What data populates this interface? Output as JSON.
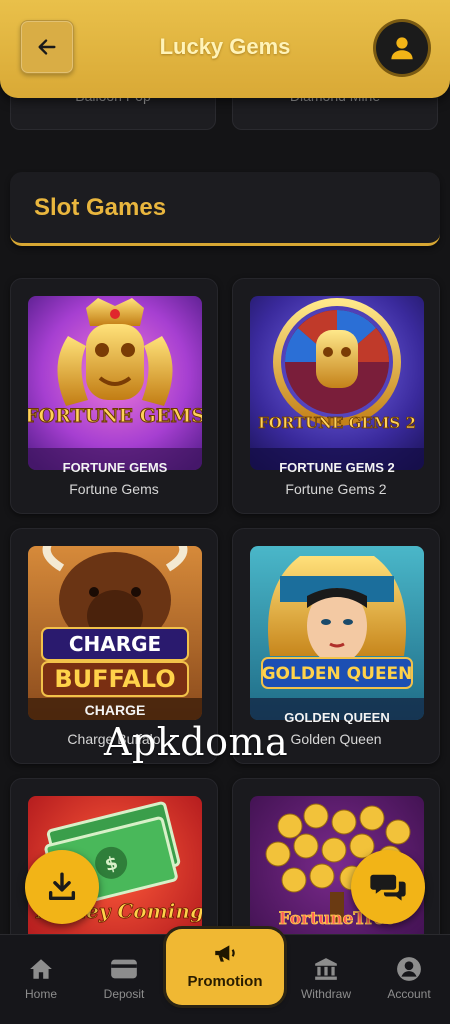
{
  "header": {
    "title": "Lucky Gems",
    "back_icon": "back-arrow-icon",
    "profile_icon": "user-icon"
  },
  "previous_row": [
    "Balloon Pop",
    "Diamond Mine"
  ],
  "section": {
    "title": "Slot Games"
  },
  "games": [
    {
      "name": "Fortune Gems",
      "banner": "FORTUNE GEMS"
    },
    {
      "name": "Fortune Gems 2",
      "banner": "FORTUNE GEMS 2"
    },
    {
      "name": "Charge Buffalo",
      "banner": "CHARGE"
    },
    {
      "name": "Golden Queen",
      "banner": "GOLDEN QUEEN"
    },
    {
      "name": "Money Coming",
      "banner": ""
    },
    {
      "name": "Fortune Tree",
      "banner": ""
    }
  ],
  "thumb_logos": {
    "fortune_gems": "FORTUNE GEMS",
    "fortune_gems_2": "FORTUNE GEMS 2",
    "charge_buffalo_1": "CHARGE",
    "charge_buffalo_2": "BUFFALO",
    "golden_queen": "GOLDEN QUEEN",
    "money_coming": "Money Coming",
    "fortune_tree": "FortuneTree"
  },
  "watermark": "Apkdoma",
  "fabs": {
    "download_icon": "download-icon",
    "chat_icon": "chat-icon"
  },
  "nav": {
    "home": "Home",
    "deposit": "Deposit",
    "promotion": "Promotion",
    "withdraw": "Withdraw",
    "account": "Account"
  },
  "colors": {
    "accent": "#e9b63e",
    "header_bg": "#e3b840",
    "page_bg": "#141416",
    "fab": "#f2b417"
  }
}
